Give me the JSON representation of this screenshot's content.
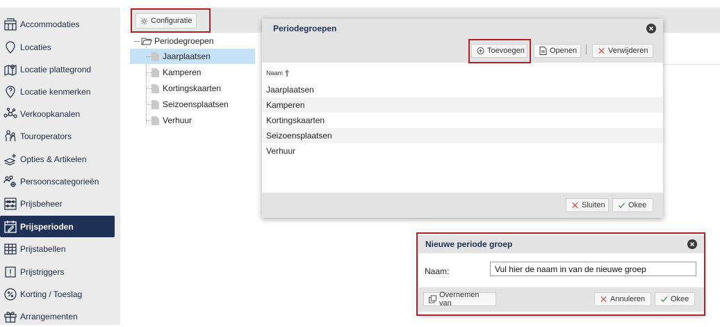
{
  "sidebar": {
    "items": [
      {
        "label": "Accommodaties",
        "icon": "building-icon"
      },
      {
        "label": "Locaties",
        "icon": "location-pin-icon"
      },
      {
        "label": "Locatie plattegrond",
        "icon": "map-icon"
      },
      {
        "label": "Locatie kenmerken",
        "icon": "location-question-icon"
      },
      {
        "label": "Verkoopkanalen",
        "icon": "network-icon"
      },
      {
        "label": "Touroperators",
        "icon": "people-icon"
      },
      {
        "label": "Opties & Artikelen",
        "icon": "stack-plus-icon"
      },
      {
        "label": "Persoonscategorieën",
        "icon": "people-gear-icon"
      },
      {
        "label": "Prijsbeheer",
        "icon": "abacus-icon"
      },
      {
        "label": "Prijsperioden",
        "icon": "calendar-edit-icon",
        "active": true
      },
      {
        "label": "Prijstabellen",
        "icon": "table-icon"
      },
      {
        "label": "Prijstriggers",
        "icon": "alert-box-icon"
      },
      {
        "label": "Korting / Toeslag",
        "icon": "percent-badge-icon"
      },
      {
        "label": "Arrangementen",
        "icon": "gift-icon"
      }
    ]
  },
  "toolbar": {
    "config_label": "Configuratie"
  },
  "tree": {
    "root": "Periodegroepen",
    "items": [
      "Jaarplaatsen",
      "Kamperen",
      "Kortingskaarten",
      "Seizoensplaatsen",
      "Verhuur"
    ],
    "selected_index": 0
  },
  "dialog_groups": {
    "title": "Periodegroepen",
    "add_label": "Toevoegen",
    "open_label": "Openen",
    "delete_label": "Verwijderen",
    "column_header": "Naam",
    "rows": [
      "Jaarplaatsen",
      "Kamperen",
      "Kortingskaarten",
      "Seizoensplaatsen",
      "Verhuur"
    ],
    "close_label": "Sluiten",
    "ok_label": "Okee"
  },
  "dialog_new": {
    "title": "Nieuwe periode groep",
    "name_label": "Naam:",
    "name_value": "Vul hier de naam in van de nieuwe groep",
    "copy_label": "Overnemen van",
    "cancel_label": "Annuleren",
    "ok_label": "Okee"
  },
  "colors": {
    "accent": "#203158",
    "highlight": "#b21f24",
    "selection": "#c6e0f5"
  }
}
